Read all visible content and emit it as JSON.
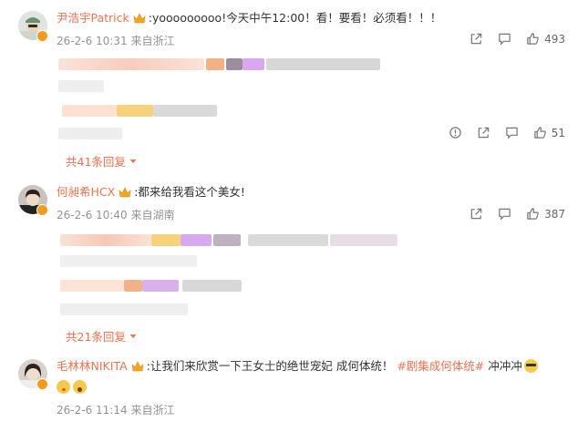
{
  "comments": [
    {
      "username": "尹浩宇Patrick",
      "text": ":yooooooooo!今天中午12:00！看！要看！必须看！！！",
      "date": "26-2-6 10:31",
      "location": "来自浙江",
      "likes": "493",
      "reply_likes": "51",
      "replies_label": "共41条回复"
    },
    {
      "username": "何昶希HCX",
      "text": ":都来给我看这个美女!",
      "date": "26-2-6 10:40",
      "location": "来自湖南",
      "likes": "387",
      "replies_label": "共21条回复"
    },
    {
      "username": "毛林林NIKITA",
      "text": ":让我们来欣赏一下王女士的绝世宠妃 成何体统！",
      "hashtag": "#剧集成何体统#",
      "text_after": "冲冲冲",
      "date": "26-2-6 11:14",
      "location": "来自浙江"
    }
  ],
  "colors": {
    "accent": "#eb7350",
    "meta": "#939393",
    "vip": "#f59a1d"
  },
  "icons": [
    "share-icon",
    "comment-icon",
    "like-icon",
    "report-icon",
    "crown-icon",
    "chevron-down-icon"
  ]
}
